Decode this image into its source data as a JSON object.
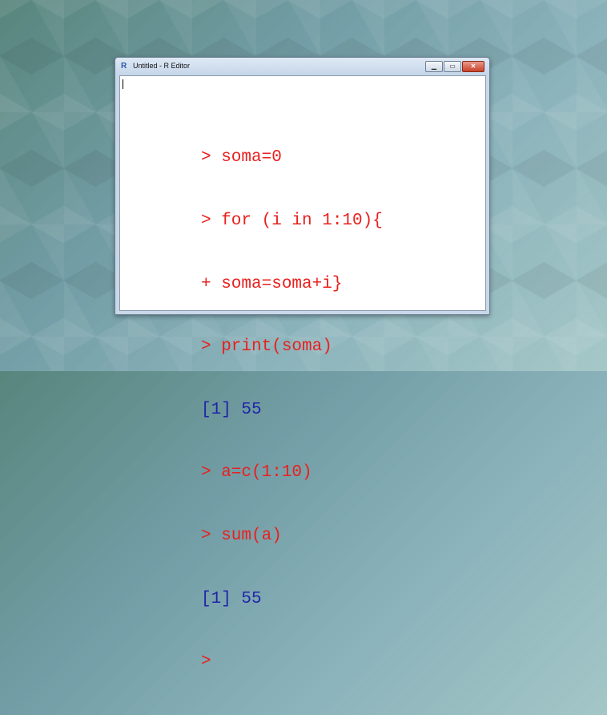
{
  "window": {
    "title": "Untitled - R Editor",
    "app_icon": "R",
    "controls": {
      "minimize": "▁",
      "maximize": "▭",
      "close": "✕"
    }
  },
  "editor": {
    "lines": [
      {
        "text": "> soma=0",
        "kind": "input"
      },
      {
        "text": "> for (i in 1:10){",
        "kind": "input"
      },
      {
        "text": "+ soma=soma+i}",
        "kind": "input"
      },
      {
        "text": "> print(soma)",
        "kind": "input"
      },
      {
        "text": "[1] 55",
        "kind": "output"
      },
      {
        "text": "> a=c(1:10)",
        "kind": "input"
      },
      {
        "text": "> sum(a)",
        "kind": "input"
      },
      {
        "text": "[1] 55",
        "kind": "output"
      },
      {
        "text": ">",
        "kind": "input"
      }
    ]
  },
  "colors": {
    "input": "#e8201e",
    "output": "#1f25a8"
  }
}
